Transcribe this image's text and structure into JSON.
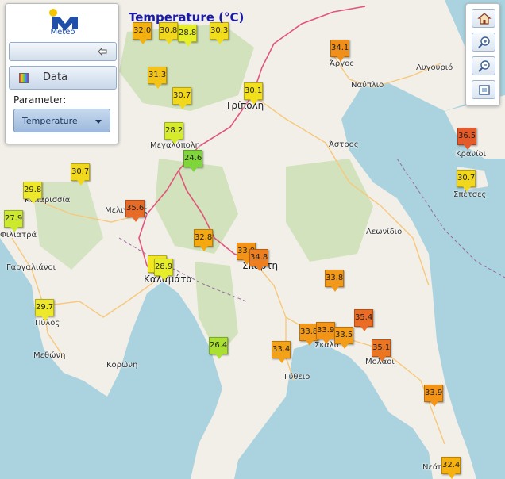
{
  "map": {
    "title": "Temperature (°C)",
    "colors": {
      "sea": "#aad3df",
      "land": "#f2efe9",
      "forest": "#c8deb0",
      "motorway": "#e2557a",
      "road": "#f7c87b",
      "boundary": "#9a6aa0"
    },
    "places": [
      {
        "name": "Άργος",
        "big": false
      },
      {
        "name": "Ναύπλιο",
        "big": false
      },
      {
        "name": "Λυγουριό",
        "big": false
      },
      {
        "name": "Τρίπολη",
        "big": true
      },
      {
        "name": "Μεγαλόπολη",
        "big": false
      },
      {
        "name": "Άστρος",
        "big": false
      },
      {
        "name": "Κρανίδι",
        "big": false
      },
      {
        "name": "Σπέτσες",
        "big": false
      },
      {
        "name": "Κυπαρισσία",
        "big": false
      },
      {
        "name": "Μελιγαλάς",
        "big": false
      },
      {
        "name": "Φιλιατρά",
        "big": false
      },
      {
        "name": "Γαργαλιάνοι",
        "big": false
      },
      {
        "name": "Καλαμάτα",
        "big": true
      },
      {
        "name": "Σπάρτη",
        "big": true
      },
      {
        "name": "Λεωνίδιο",
        "big": false
      },
      {
        "name": "Πύλος",
        "big": false
      },
      {
        "name": "Μεθώνη",
        "big": false
      },
      {
        "name": "Κορώνη",
        "big": false
      },
      {
        "name": "Σκάλα",
        "big": false
      },
      {
        "name": "Μολάοι",
        "big": false
      },
      {
        "name": "Γύθειο",
        "big": false
      },
      {
        "name": "Νεάπολη",
        "big": false
      }
    ],
    "stations": [
      {
        "value": "32.0",
        "color": "#f5b10f"
      },
      {
        "value": "30.8",
        "color": "#f2d81c"
      },
      {
        "value": "28.8",
        "color": "#e6ee2a"
      },
      {
        "value": "30.3",
        "color": "#f2dd1d"
      },
      {
        "value": "34.1",
        "color": "#f0901a"
      },
      {
        "value": "31.3",
        "color": "#f5c316"
      },
      {
        "value": "30.7",
        "color": "#f2d81c"
      },
      {
        "value": "30.1",
        "color": "#f3e01c"
      },
      {
        "value": "28.2",
        "color": "#d6ec2b"
      },
      {
        "value": "24.6",
        "color": "#7fd63a"
      },
      {
        "value": "36.5",
        "color": "#e55a2b"
      },
      {
        "value": "30.7",
        "color": "#f2d81c"
      },
      {
        "value": "29.8",
        "color": "#eee82a"
      },
      {
        "value": "30.7",
        "color": "#f2d81c"
      },
      {
        "value": "35.6",
        "color": "#e86a27"
      },
      {
        "value": "27.9",
        "color": "#cce92d"
      },
      {
        "value": "32.8",
        "color": "#f5a80f"
      },
      {
        "value": "33.9",
        "color": "#f39417"
      },
      {
        "value": "34.8",
        "color": "#ee7f20"
      },
      {
        "value": "3",
        "color": "#f2e61f"
      },
      {
        "value": "28.9",
        "color": "#e6ee2a"
      },
      {
        "value": "33.8",
        "color": "#f3991a"
      },
      {
        "value": "29.7",
        "color": "#eee82a"
      },
      {
        "value": "35.4",
        "color": "#ea6c25"
      },
      {
        "value": "33.8",
        "color": "#f3991a"
      },
      {
        "value": "33.9",
        "color": "#f39417"
      },
      {
        "value": "33.5",
        "color": "#f39d18"
      },
      {
        "value": "35.1",
        "color": "#ec7522"
      },
      {
        "value": "33.4",
        "color": "#f3a218"
      },
      {
        "value": "26.4",
        "color": "#a9e032"
      },
      {
        "value": "33.9",
        "color": "#f39417"
      },
      {
        "value": "32.4",
        "color": "#f5b10f"
      }
    ]
  },
  "panel": {
    "logo_text": "Meteo",
    "data_label": "Data",
    "parameter_label": "Parameter:",
    "parameter_value": "Temperature"
  },
  "toolbar": {
    "icons": [
      "home-icon",
      "zoom-in-icon",
      "zoom-out-icon",
      "full-extent-icon"
    ]
  }
}
